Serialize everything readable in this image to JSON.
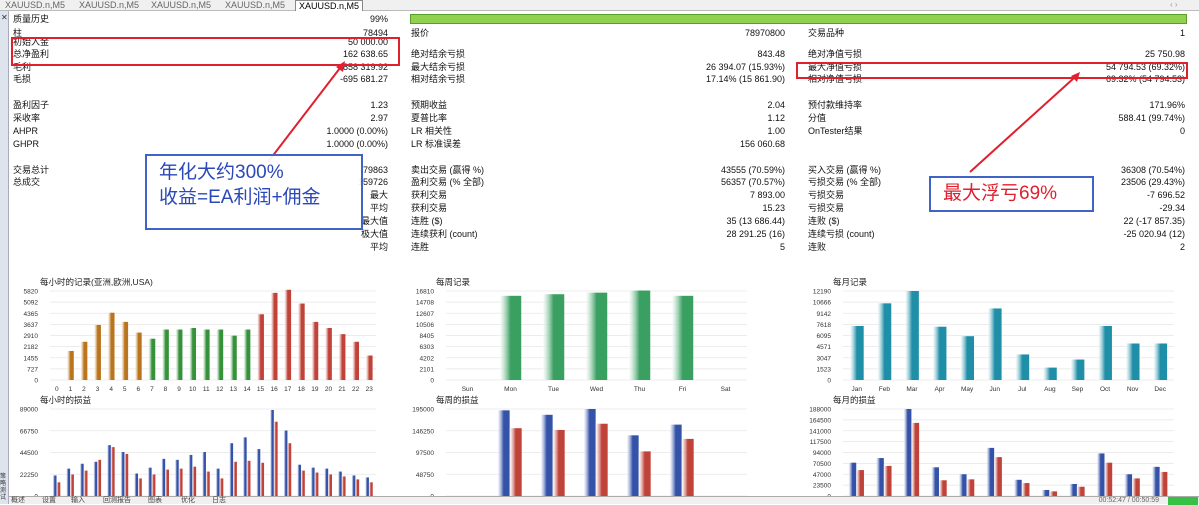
{
  "tabs": [
    "XAUUSD.n,M5",
    "XAUUSD.n,M5",
    "XAUUSD.n,M5",
    "XAUUSD.n,M5",
    "XAUUSD.n,M5"
  ],
  "active_tab": 4,
  "tab_controls": "‹ ›",
  "sidebar": {
    "close": "✕",
    "label": "策略测试"
  },
  "report": {
    "history_quality_label": "质量历史",
    "history_quality_value": "99%",
    "bars_label": "柱",
    "bars_value": "78494",
    "ticks_label": "报价",
    "ticks_value": "78970800",
    "symbols_label": "交易品种",
    "symbols_value": "1",
    "rows": [
      {
        "y": 41,
        "c1l": "初始入金",
        "c1v": "50 000.00"
      },
      {
        "y": 53,
        "c1l": "总净盈利",
        "c1v": "162 638.65",
        "c2l": "绝对结余亏损",
        "c2v": "843.48",
        "c3l": "绝对净值亏损",
        "c3v": "25 750.98"
      },
      {
        "y": 66,
        "c1l": "毛利",
        "c1v": "858 319.92",
        "c2l": "最大结余亏损",
        "c2v": "26 394.07 (15.93%)",
        "c3l": "最大净值亏损",
        "c3v": "54 794.53 (69.32%)"
      },
      {
        "y": 78,
        "c1l": "毛损",
        "c1v": "-695 681.27",
        "c2l": "相对结余亏损",
        "c2v": "17.14% (15 861.90)",
        "c3l": "相对净值亏损",
        "c3v": "69.32% (54 794.53)"
      },
      {
        "y": 104,
        "c1l": "盈利因子",
        "c1v": "1.23",
        "c2l": "预期收益",
        "c2v": "2.04",
        "c3l": "预付款维持率",
        "c3v": "171.96%"
      },
      {
        "y": 117,
        "c1l": "采收率",
        "c1v": "2.97",
        "c2l": "夏普比率",
        "c2v": "1.12",
        "c3l": "分值",
        "c3v": "588.41 (99.74%)"
      },
      {
        "y": 130,
        "c1l": "AHPR",
        "c1v": "1.0000 (0.00%)",
        "c2l": "LR 相关性",
        "c2v": "1.00",
        "c3l": "OnTester结果",
        "c3v": "0"
      },
      {
        "y": 143,
        "c1l": "GHPR",
        "c1v": "1.0000 (0.00%)",
        "c2l": "LR 标准误差",
        "c2v": "156 060.68"
      },
      {
        "y": 169,
        "c1l": "交易总计",
        "c1v": "79863",
        "c2l": "卖出交易 (赢得 %)",
        "c2v": "43555 (70.59%)",
        "c3l": "买入交易 (赢得 %)",
        "c3v": "36308 (70.54%)"
      },
      {
        "y": 181,
        "c1l": "总成交",
        "c1v": "159726",
        "c2l": "盈利交易 (% 全部)",
        "c2v": "56357 (70.57%)",
        "c3l": "亏损交易 (% 全部)",
        "c3v": "23506 (29.43%)"
      },
      {
        "y": 194,
        "c1r": "最大",
        "c2l": "获利交易",
        "c2v": "7 893.00",
        "c3l": "亏损交易",
        "c3v": "-7 696.52"
      },
      {
        "y": 207,
        "c1r": "平均",
        "c2l": "获利交易",
        "c2v": "15.23",
        "c3l": "亏损交易",
        "c3v": "-29.34"
      },
      {
        "y": 220,
        "c1r": "最大值",
        "c2l": "连胜 ($)",
        "c2v": "35 (13 686.44)",
        "c3l": "连败 ($)",
        "c3v": "22 (-17 857.35)"
      },
      {
        "y": 233,
        "c1r": "极大值",
        "c2l": "连续获利 (count)",
        "c2v": "28 291.25 (16)",
        "c3l": "连续亏损 (count)",
        "c3v": "-25 020.94 (12)"
      },
      {
        "y": 246,
        "c1r": "平均",
        "c2l": "连胜",
        "c2v": "5",
        "c3l": "连败",
        "c3v": "2"
      }
    ]
  },
  "annotations": {
    "left_line1": "年化大约300%",
    "left_line2": "收益=EA利润+佣金",
    "right": "最大浮亏69%"
  },
  "colors": {
    "accent_red": "#e0202e",
    "accent_blue": "#4063c8",
    "quality_bar": "#92d050"
  },
  "chart_data": [
    {
      "type": "bar",
      "title": "每小时的记录(亚洲,欧洲,USA)",
      "categories": [
        "0",
        "1",
        "2",
        "3",
        "4",
        "5",
        "6",
        "7",
        "8",
        "9",
        "10",
        "11",
        "12",
        "13",
        "14",
        "15",
        "16",
        "17",
        "18",
        "19",
        "20",
        "21",
        "22",
        "23"
      ],
      "values": [
        0,
        1900,
        2500,
        3600,
        4400,
        3800,
        3100,
        2700,
        3300,
        3300,
        3400,
        3300,
        3300,
        2900,
        3300,
        4300,
        5700,
        5900,
        5000,
        3800,
        3400,
        3000,
        2500,
        1600
      ],
      "ylim": [
        0,
        5820
      ],
      "yticks": [
        "5820",
        "5092",
        "4365",
        "3637",
        "2910",
        "2182",
        "1455",
        "727",
        "0"
      ],
      "colors": [
        "#b9741d",
        "#b9741d",
        "#b9741d",
        "#b9741d",
        "#b9741d",
        "#b9741d",
        "#b9741d",
        "#35923a",
        "#35923a",
        "#35923a",
        "#35923a",
        "#35923a",
        "#35923a",
        "#35923a",
        "#35923a",
        "#c0433a",
        "#c0433a",
        "#c0433a",
        "#c0433a",
        "#c0433a",
        "#c0433a",
        "#c0433a",
        "#c0433a",
        "#c0433a"
      ]
    },
    {
      "type": "bar",
      "title": "每周记录",
      "categories": [
        "Sun",
        "Mon",
        "Tue",
        "Wed",
        "Thu",
        "Fri",
        "Sat"
      ],
      "values": [
        0,
        15900,
        16200,
        16500,
        16900,
        15900,
        0
      ],
      "ylim": [
        0,
        16810
      ],
      "yticks": [
        "16810",
        "14708",
        "12607",
        "10506",
        "8405",
        "6303",
        "4202",
        "2101",
        "0"
      ],
      "colors": [
        "#3aa062",
        "#3aa062",
        "#3aa062",
        "#3aa062",
        "#3aa062",
        "#3aa062",
        "#3aa062"
      ]
    },
    {
      "type": "bar",
      "title": "每月记录",
      "categories": [
        "Jan",
        "Feb",
        "Mar",
        "Apr",
        "May",
        "Jun",
        "Jul",
        "Aug",
        "Sep",
        "Oct",
        "Nov",
        "Dec"
      ],
      "values": [
        7400,
        10500,
        12190,
        7300,
        6000,
        9800,
        3500,
        1700,
        2800,
        7400,
        5000,
        5000
      ],
      "ylim": [
        0,
        12190
      ],
      "yticks": [
        "12190",
        "10666",
        "9142",
        "7618",
        "6095",
        "4571",
        "3047",
        "1523",
        "0"
      ],
      "colors": [
        "#1f8fa8",
        "#1f8fa8",
        "#1f8fa8",
        "#1f8fa8",
        "#1f8fa8",
        "#1f8fa8",
        "#1f8fa8",
        "#1f8fa8",
        "#1f8fa8",
        "#1f8fa8",
        "#1f8fa8",
        "#1f8fa8"
      ]
    },
    {
      "type": "bar",
      "title": "每小时的损益",
      "categories": [
        "0",
        "1",
        "2",
        "3",
        "4",
        "5",
        "6",
        "7",
        "8",
        "9",
        "10",
        "11",
        "12",
        "13",
        "14",
        "15",
        "16",
        "17",
        "18",
        "19",
        "20",
        "21",
        "22",
        "23"
      ],
      "series": [
        {
          "values": [
            21000,
            28000,
            33000,
            35000,
            52000,
            45000,
            23000,
            29000,
            38000,
            37000,
            42000,
            45000,
            28000,
            54000,
            60000,
            48000,
            88000,
            67000,
            32000,
            29000,
            28000,
            25000,
            21000,
            19000
          ]
        },
        {
          "values": [
            14000,
            22000,
            26000,
            37000,
            50000,
            43000,
            18000,
            22000,
            27000,
            28000,
            30000,
            25000,
            18000,
            35000,
            36000,
            34000,
            76000,
            54000,
            26000,
            24000,
            22000,
            20000,
            17000,
            14000
          ]
        }
      ],
      "ylim": [
        0,
        89000
      ],
      "yticks": [
        "89000",
        "66750",
        "44500",
        "22250",
        "0"
      ],
      "colors": [
        "#3452a8",
        "#c0433a"
      ]
    },
    {
      "type": "bar",
      "title": "每周的损益",
      "categories": [
        "Sun",
        "Mon",
        "Tue",
        "Wed",
        "Thu",
        "Fri",
        "Sat"
      ],
      "series": [
        {
          "values": [
            0,
            192000,
            182000,
            195000,
            136000,
            160000,
            0
          ]
        },
        {
          "values": [
            0,
            152000,
            148000,
            162000,
            100000,
            128000,
            0
          ]
        }
      ],
      "ylim": [
        0,
        195000
      ],
      "yticks": [
        "195000",
        "146250",
        "97500",
        "48750",
        "0"
      ],
      "colors": [
        "#3452a8",
        "#c0433a"
      ]
    },
    {
      "type": "bar",
      "title": "每月的损益",
      "categories": [
        "Jan",
        "Feb",
        "Mar",
        "Apr",
        "May",
        "Jun",
        "Jul",
        "Aug",
        "Sep",
        "Oct",
        "Nov",
        "Dec"
      ],
      "series": [
        {
          "values": [
            72000,
            82000,
            188000,
            62000,
            47000,
            104000,
            35000,
            13000,
            26000,
            92000,
            47000,
            63000
          ]
        },
        {
          "values": [
            56000,
            65000,
            158000,
            34000,
            36000,
            84000,
            28000,
            10000,
            20000,
            72000,
            38000,
            52000
          ]
        }
      ],
      "ylim": [
        0,
        188000
      ],
      "yticks": [
        "188000",
        "164500",
        "141000",
        "117500",
        "94000",
        "70500",
        "47000",
        "23500",
        "0"
      ],
      "colors": [
        "#3452a8",
        "#c0433a"
      ]
    }
  ],
  "bottom_tabs": [
    "概述",
    "设置",
    "输入",
    "回测报告",
    "图表",
    "优化",
    "日志"
  ],
  "bottom_status": "00:52:47 / 00:50:59"
}
